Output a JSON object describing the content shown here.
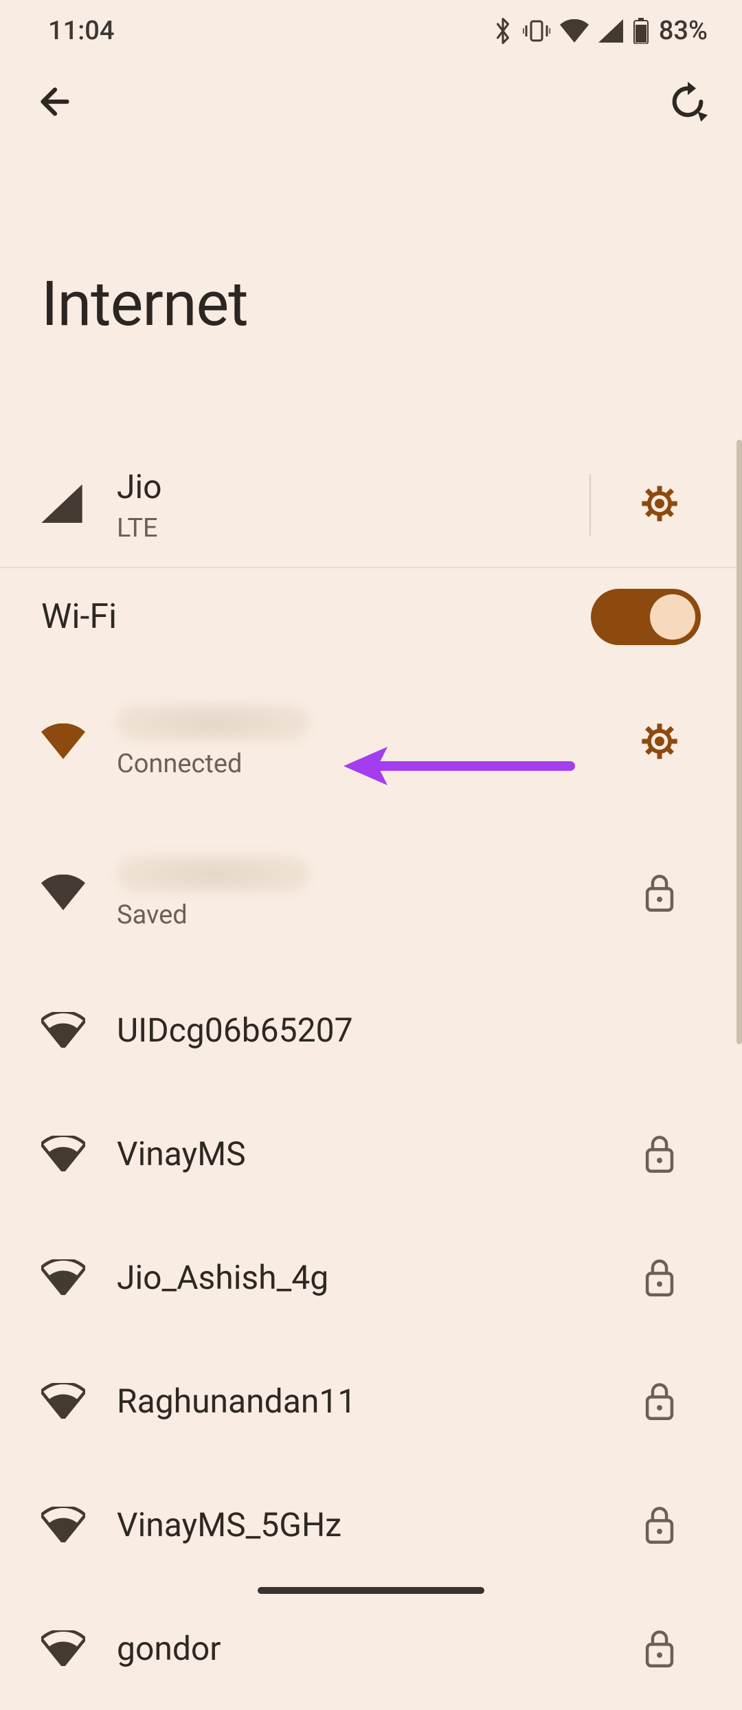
{
  "status": {
    "time": "11:04",
    "battery_text": "83%"
  },
  "page": {
    "title": "Internet"
  },
  "mobile": {
    "carrier": "Jio",
    "network": "LTE"
  },
  "wifi": {
    "label": "Wi-Fi",
    "enabled": true,
    "networks": [
      {
        "name": "",
        "status": "Connected",
        "signal": "full",
        "secured": false,
        "has_settings": true,
        "connected": true,
        "blurred": true
      },
      {
        "name": "",
        "status": "Saved",
        "signal": "full",
        "secured": true,
        "has_settings": false,
        "connected": false,
        "blurred": true
      },
      {
        "name": "UIDcg06b65207",
        "status": "",
        "signal": "med",
        "secured": false,
        "has_settings": false,
        "connected": false,
        "blurred": false
      },
      {
        "name": "VinayMS",
        "status": "",
        "signal": "med",
        "secured": true,
        "has_settings": false,
        "connected": false,
        "blurred": false
      },
      {
        "name": "Jio_Ashish_4g",
        "status": "",
        "signal": "med",
        "secured": true,
        "has_settings": false,
        "connected": false,
        "blurred": false
      },
      {
        "name": "Raghunandan11",
        "status": "",
        "signal": "med",
        "secured": true,
        "has_settings": false,
        "connected": false,
        "blurred": false
      },
      {
        "name": "VinayMS_5GHz",
        "status": "",
        "signal": "med",
        "secured": true,
        "has_settings": false,
        "connected": false,
        "blurred": false
      },
      {
        "name": "gondor",
        "status": "",
        "signal": "med",
        "secured": true,
        "has_settings": false,
        "connected": false,
        "blurred": false
      }
    ]
  },
  "colors": {
    "accent": "#8c4a0f",
    "icon_dark": "#433a31"
  }
}
